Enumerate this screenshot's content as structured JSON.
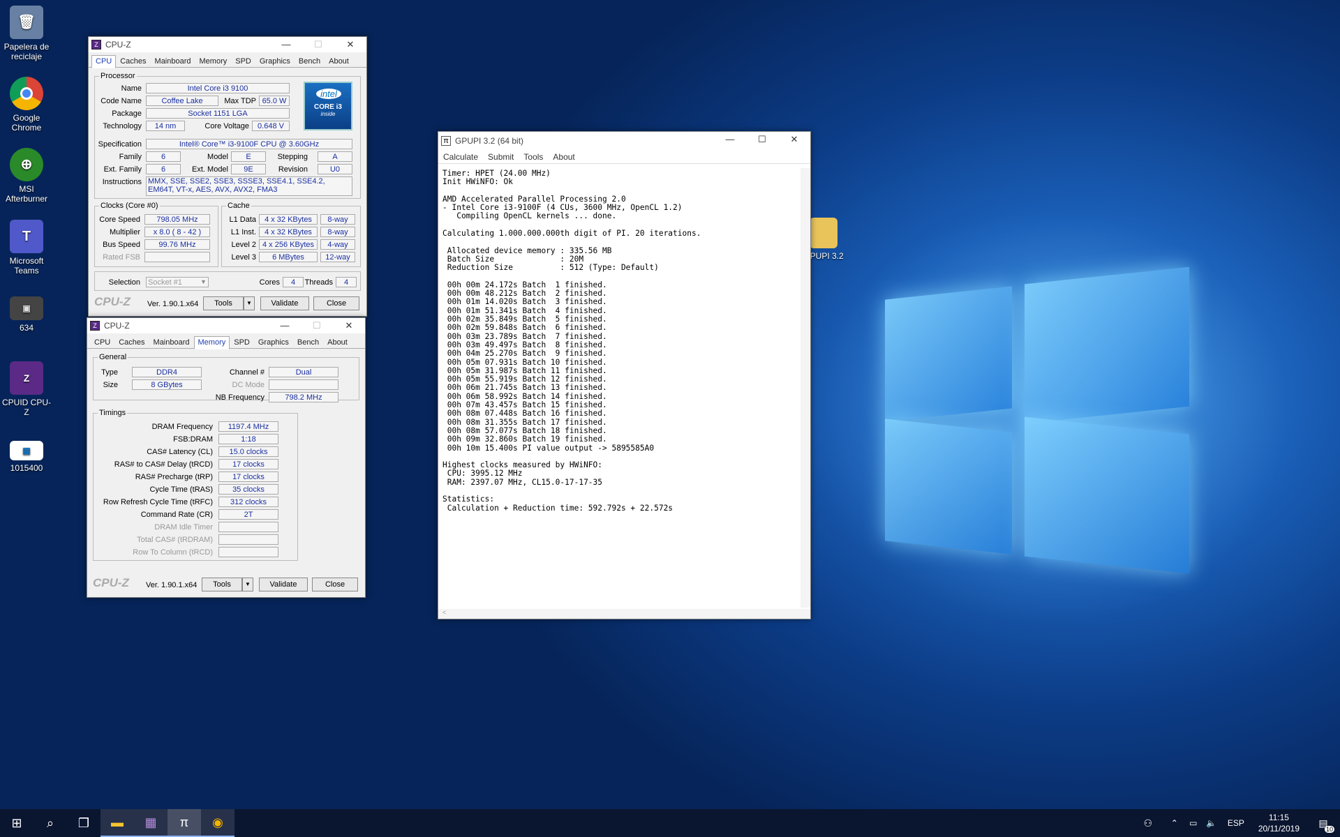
{
  "desktop": {
    "icons": [
      {
        "label": "Papelera de reciclaje",
        "icon": "recycle-bin-icon"
      },
      {
        "label": "Google Chrome",
        "icon": "chrome-icon"
      },
      {
        "label": "MSI Afterburner",
        "icon": "afterburner-icon"
      },
      {
        "label": "Microsoft Teams",
        "icon": "teams-icon"
      },
      {
        "label": "634",
        "icon": "image-file-icon"
      },
      {
        "label": "CPUID CPU-Z",
        "icon": "cpuz-icon"
      },
      {
        "label": "1015400",
        "icon": "image-file-icon"
      }
    ],
    "gpupi_icon": "GPUPI 3.2"
  },
  "cpuz1": {
    "title": "CPU-Z",
    "tabs": [
      "CPU",
      "Caches",
      "Mainboard",
      "Memory",
      "SPD",
      "Graphics",
      "Bench",
      "About"
    ],
    "active_tab": "CPU",
    "processor": {
      "legend": "Processor",
      "name_l": "Name",
      "name": "Intel Core i3 9100",
      "codename_l": "Code Name",
      "codename": "Coffee Lake",
      "maxtdp_l": "Max TDP",
      "maxtdp": "65.0 W",
      "package_l": "Package",
      "package": "Socket 1151 LGA",
      "tech_l": "Technology",
      "tech": "14 nm",
      "corev_l": "Core Voltage",
      "corev": "0.648 V",
      "spec_l": "Specification",
      "spec": "Intel® Core™ i3-9100F CPU @ 3.60GHz",
      "family_l": "Family",
      "family": "6",
      "model_l": "Model",
      "model": "E",
      "stepping_l": "Stepping",
      "stepping": "A",
      "extfam_l": "Ext. Family",
      "extfam": "6",
      "extmodel_l": "Ext. Model",
      "extmodel": "9E",
      "revision_l": "Revision",
      "revision": "U0",
      "instr_l": "Instructions",
      "instr": "MMX, SSE, SSE2, SSE3, SSSE3, SSE4.1, SSE4.2, EM64T, VT-x, AES, AVX, AVX2, FMA3",
      "badge_top": "intel",
      "badge_mid": "CORE i3",
      "badge_bot": "inside"
    },
    "clocks": {
      "legend": "Clocks (Core #0)",
      "core_speed_l": "Core Speed",
      "core_speed": "798.05 MHz",
      "multiplier_l": "Multiplier",
      "multiplier": "x 8.0 ( 8 - 42 )",
      "bus_speed_l": "Bus Speed",
      "bus_speed": "99.76 MHz",
      "rated_fsb_l": "Rated FSB"
    },
    "cache": {
      "legend": "Cache",
      "l1d_l": "L1 Data",
      "l1d": "4 x 32 KBytes",
      "l1d_w": "8-way",
      "l1i_l": "L1 Inst.",
      "l1i": "4 x 32 KBytes",
      "l1i_w": "8-way",
      "l2_l": "Level 2",
      "l2": "4 x 256 KBytes",
      "l2_w": "4-way",
      "l3_l": "Level 3",
      "l3": "6 MBytes",
      "l3_w": "12-way"
    },
    "selection_l": "Selection",
    "selection": "Socket #1",
    "cores_l": "Cores",
    "cores": "4",
    "threads_l": "Threads",
    "threads": "4",
    "logo": "CPU-Z",
    "version": "Ver. 1.90.1.x64",
    "tools": "Tools",
    "validate": "Validate",
    "close": "Close"
  },
  "cpuz2": {
    "title": "CPU-Z",
    "tabs": [
      "CPU",
      "Caches",
      "Mainboard",
      "Memory",
      "SPD",
      "Graphics",
      "Bench",
      "About"
    ],
    "active_tab": "Memory",
    "general": {
      "legend": "General",
      "type_l": "Type",
      "type": "DDR4",
      "size_l": "Size",
      "size": "8 GBytes",
      "channel_l": "Channel #",
      "channel": "Dual",
      "dcmode_l": "DC Mode",
      "nbfreq_l": "NB Frequency",
      "nbfreq": "798.2 MHz"
    },
    "timings": {
      "legend": "Timings",
      "rows": [
        {
          "label": "DRAM Frequency",
          "value": "1197.4 MHz"
        },
        {
          "label": "FSB:DRAM",
          "value": "1:18"
        },
        {
          "label": "CAS# Latency (CL)",
          "value": "15.0 clocks"
        },
        {
          "label": "RAS# to CAS# Delay (tRCD)",
          "value": "17 clocks"
        },
        {
          "label": "RAS# Precharge (tRP)",
          "value": "17 clocks"
        },
        {
          "label": "Cycle Time (tRAS)",
          "value": "35 clocks"
        },
        {
          "label": "Row Refresh Cycle Time (tRFC)",
          "value": "312 clocks"
        },
        {
          "label": "Command Rate (CR)",
          "value": "2T"
        },
        {
          "label": "DRAM Idle Timer",
          "value": ""
        },
        {
          "label": "Total CAS# (tRDRAM)",
          "value": ""
        },
        {
          "label": "Row To Column (tRCD)",
          "value": ""
        }
      ]
    },
    "logo": "CPU-Z",
    "version": "Ver. 1.90.1.x64",
    "tools": "Tools",
    "validate": "Validate",
    "close": "Close"
  },
  "gpupi": {
    "title": "GPUPI 3.2 (64 bit)",
    "menu": [
      "Calculate",
      "Submit",
      "Tools",
      "About"
    ],
    "output": "Timer: HPET (24.00 MHz)\nInit HWiNFO: Ok\n\nAMD Accelerated Parallel Processing 2.0\n- Intel Core i3-9100F (4 CUs, 3600 MHz, OpenCL 1.2)\n   Compiling OpenCL kernels ... done.\n\nCalculating 1.000.000.000th digit of PI. 20 iterations.\n\n Allocated device memory : 335.56 MB\n Batch Size              : 20M\n Reduction Size          : 512 (Type: Default)\n\n 00h 00m 24.172s Batch  1 finished.\n 00h 00m 48.212s Batch  2 finished.\n 00h 01m 14.020s Batch  3 finished.\n 00h 01m 51.341s Batch  4 finished.\n 00h 02m 35.849s Batch  5 finished.\n 00h 02m 59.848s Batch  6 finished.\n 00h 03m 23.789s Batch  7 finished.\n 00h 03m 49.497s Batch  8 finished.\n 00h 04m 25.270s Batch  9 finished.\n 00h 05m 07.931s Batch 10 finished.\n 00h 05m 31.987s Batch 11 finished.\n 00h 05m 55.919s Batch 12 finished.\n 00h 06m 21.745s Batch 13 finished.\n 00h 06m 58.992s Batch 14 finished.\n 00h 07m 43.457s Batch 15 finished.\n 00h 08m 07.448s Batch 16 finished.\n 00h 08m 31.355s Batch 17 finished.\n 00h 08m 57.077s Batch 18 finished.\n 00h 09m 32.860s Batch 19 finished.\n 00h 10m 15.400s PI value output -> 5895585A0\n\nHighest clocks measured by HWiNFO:\n CPU: 3995.12 MHz\n RAM: 2397.07 MHz, CL15.0-17-17-35\n\nStatistics:\n Calculation + Reduction time: 592.792s + 22.572s"
  },
  "taskbar": {
    "lang": "ESP",
    "time": "11:15",
    "date": "20/11/2019",
    "notif_count": "10"
  }
}
